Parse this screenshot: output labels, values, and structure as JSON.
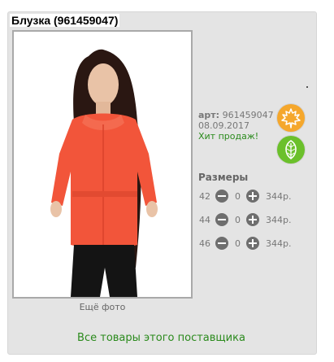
{
  "product": {
    "title": "Блузка (961459047)",
    "more_photo_label": "Ещё фото",
    "art_label": "арт:",
    "art_value": "961459047",
    "date": "08.09.2017",
    "hit_label": "Хит продаж!",
    "badges": [
      {
        "icon": "maple-leaf-icon",
        "color": "#f5a72c"
      },
      {
        "icon": "leaf-icon",
        "color": "#6bc02b"
      }
    ]
  },
  "sizes": {
    "title": "Размеры",
    "rows": [
      {
        "size": "42",
        "qty": "0",
        "price": "344р."
      },
      {
        "size": "44",
        "qty": "0",
        "price": "344р."
      },
      {
        "size": "46",
        "qty": "0",
        "price": "344р."
      }
    ]
  },
  "supplier_link": "Все товары этого поставщика",
  "colors": {
    "accent_green": "#2a8a1c",
    "card_bg": "#e4e4e4",
    "blouse": "#f2553a"
  }
}
